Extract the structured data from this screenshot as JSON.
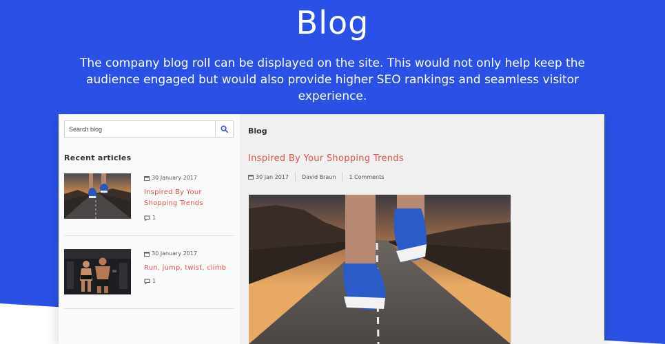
{
  "hero": {
    "title": "Blog",
    "description": "The company blog roll can be displayed on the site. This would not only help keep the audience engaged but would also provide higher SEO rankings and seamless visitor experience."
  },
  "sidebar": {
    "search_placeholder": "Search blog",
    "recent_title": "Recent articles",
    "articles": [
      {
        "date": "30 January 2017",
        "title": "Inspired By Your Shopping Trends",
        "comments": "1"
      },
      {
        "date": "30 January 2017",
        "title": "Run, jump, twist, climb",
        "comments": "1"
      }
    ]
  },
  "main": {
    "heading": "Blog",
    "post": {
      "title": "Inspired By Your Shopping Trends",
      "date": "30 Jan 2017",
      "author": "David Braun",
      "comments": "1 Comments"
    }
  },
  "colors": {
    "brand_blue": "#2b50e6",
    "accent_red": "#e2524f"
  },
  "icons": [
    "search-icon",
    "calendar-icon",
    "comment-icon"
  ]
}
